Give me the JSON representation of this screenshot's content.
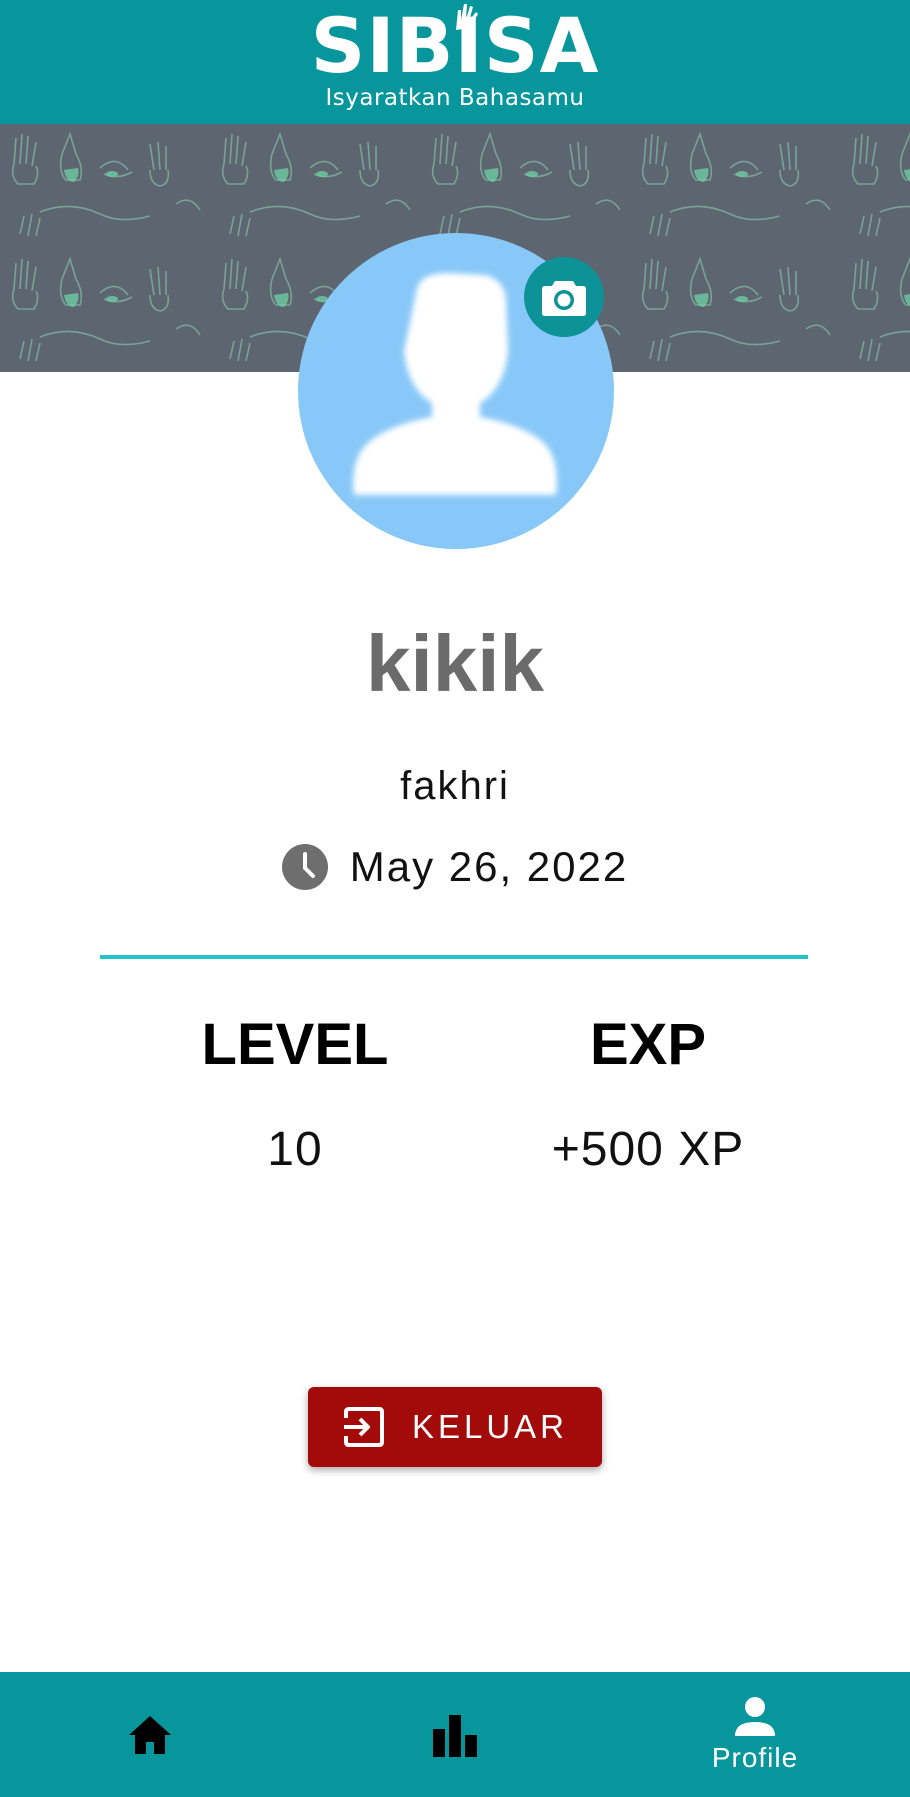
{
  "app": {
    "logo_text": "SIBISA",
    "tagline": "Isyaratkan Bahasamu"
  },
  "profile": {
    "display_name": "kikik",
    "username": "fakhri",
    "join_date": "May 26, 2022"
  },
  "stats": {
    "level_heading": "LEVEL",
    "level_value": "10",
    "exp_heading": "EXP",
    "exp_value": "+500 XP"
  },
  "actions": {
    "logout_label": "KELUAR"
  },
  "bottom_nav": {
    "items": [
      {
        "icon": "home-icon",
        "label": ""
      },
      {
        "icon": "bar-chart-icon",
        "label": ""
      },
      {
        "icon": "person-icon",
        "label": "Profile",
        "active": true
      }
    ]
  },
  "colors": {
    "primary": "#06969b",
    "banner": "#5d6670",
    "avatar_bg": "#88c8f8",
    "divider": "#23c3cb",
    "logout": "#a30a0a"
  }
}
